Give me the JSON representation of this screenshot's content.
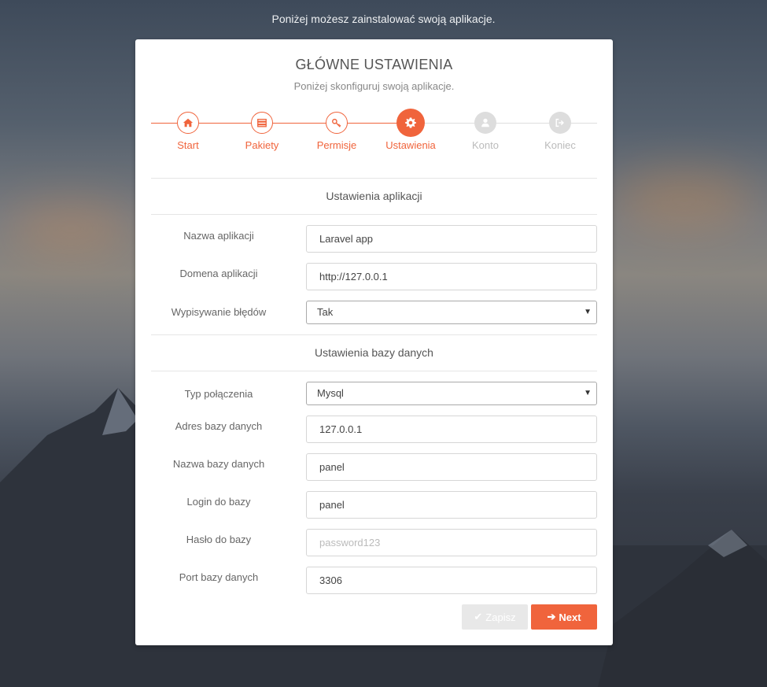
{
  "intro_text": "Poniżej możesz zainstalować swoją aplikacje.",
  "card": {
    "title": "GŁÓWNE USTAWIENIA",
    "subtitle": "Poniżej skonfiguruj swoją aplikacje."
  },
  "steps": [
    {
      "label": "Start",
      "icon": "home-icon",
      "state": "done"
    },
    {
      "label": "Pakiety",
      "icon": "server-icon",
      "state": "done"
    },
    {
      "label": "Permisje",
      "icon": "key-icon",
      "state": "done"
    },
    {
      "label": "Ustawienia",
      "icon": "gear-icon",
      "state": "active"
    },
    {
      "label": "Konto",
      "icon": "user-icon",
      "state": "todo"
    },
    {
      "label": "Koniec",
      "icon": "sign-out-icon",
      "state": "todo"
    }
  ],
  "app_section": {
    "heading": "Ustawienia aplikacji",
    "app_name": {
      "label": "Nazwa aplikacji",
      "value": "Laravel app"
    },
    "app_domain": {
      "label": "Domena aplikacji",
      "value": "http://127.0.0.1"
    },
    "debug": {
      "label": "Wypisywanie błędów",
      "value": "Tak"
    }
  },
  "db_section": {
    "heading": "Ustawienia bazy danych",
    "connection": {
      "label": "Typ połączenia",
      "value": "Mysql"
    },
    "host": {
      "label": "Adres bazy danych",
      "value": "127.0.0.1"
    },
    "name": {
      "label": "Nazwa bazy danych",
      "value": "panel"
    },
    "login": {
      "label": "Login do bazy",
      "value": "panel"
    },
    "password": {
      "label": "Hasło do bazy",
      "placeholder": "password123"
    },
    "port": {
      "label": "Port bazy danych",
      "value": "3306"
    }
  },
  "buttons": {
    "save": "Zapisz",
    "next": "Next"
  },
  "colors": {
    "accent": "#f0643c",
    "inactive_step": "#dddddd"
  }
}
